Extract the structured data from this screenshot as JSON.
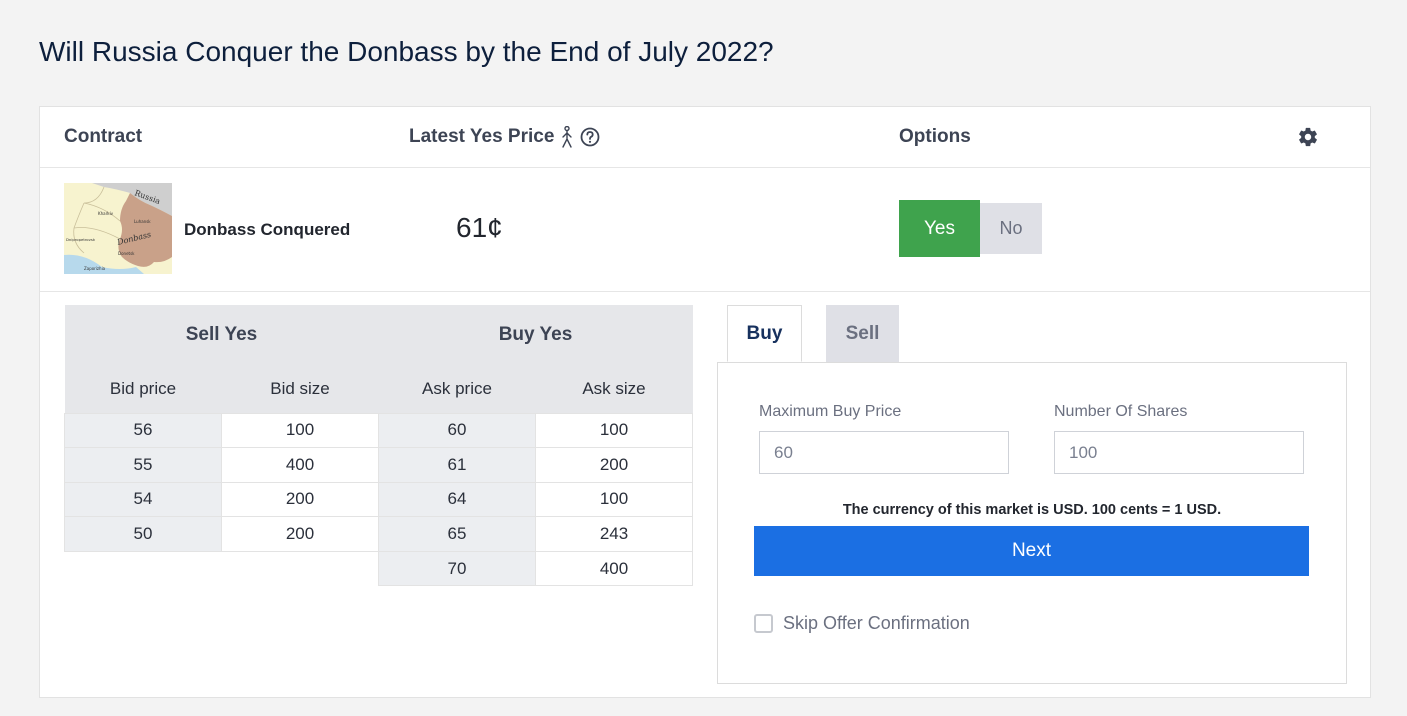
{
  "page": {
    "title": "Will Russia Conquer the Donbass by the End of July 2022?"
  },
  "header": {
    "contract": "Contract",
    "latest_price": "Latest Yes Price",
    "options": "Options"
  },
  "contract": {
    "name": "Donbass Conquered",
    "price": "61¢",
    "yes_label": "Yes",
    "no_label": "No",
    "map_labels": {
      "russia": "Russia",
      "kharkiv": "Kharkiv",
      "luhansk": "Luhansk",
      "dnipro": "Dnipropetrovsk",
      "donbass": "Donbass",
      "donetsk": "Donetsk",
      "zaporizhia": "Zaporizhia"
    }
  },
  "orderbook": {
    "sell_header": "Sell Yes",
    "buy_header": "Buy Yes",
    "cols": [
      "Bid price",
      "Bid size",
      "Ask price",
      "Ask size"
    ],
    "rows": [
      [
        "56",
        "100",
        "60",
        "100"
      ],
      [
        "55",
        "400",
        "61",
        "200"
      ],
      [
        "54",
        "200",
        "64",
        "100"
      ],
      [
        "50",
        "200",
        "65",
        "243"
      ],
      [
        "",
        "",
        "70",
        "400"
      ]
    ]
  },
  "trade": {
    "tab_buy": "Buy",
    "tab_sell": "Sell",
    "max_price_label": "Maximum Buy Price",
    "max_price_placeholder": "60",
    "shares_label": "Number Of Shares",
    "shares_placeholder": "100",
    "currency_note": "The currency of this market is USD. 100 cents = 1 USD.",
    "next_label": "Next",
    "skip_label": "Skip Offer Confirmation"
  },
  "colors": {
    "yes": "#3fa34d",
    "next": "#1b6fe3",
    "title": "#0d1f3c"
  }
}
